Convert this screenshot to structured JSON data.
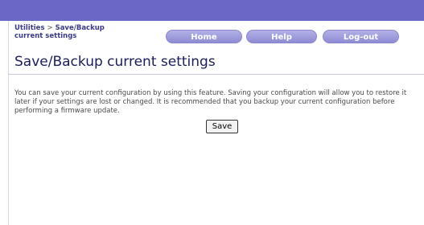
{
  "header": {
    "breadcrumb": {
      "section": "Utilities",
      "separator": ">",
      "page_line1": "Save/Backup",
      "page_line2": "current settings"
    },
    "nav": {
      "home_label": "Home",
      "help_label": "Help",
      "logout_label": "Log-out"
    }
  },
  "main": {
    "title": "Save/Backup current settings",
    "description": "You can save your current configuration by using this feature. Saving your configuration will allow you to restore it later if your settings are lost or changed. It is recommended that you backup your current configuration before performing a firmware update.",
    "save_label": "Save"
  },
  "colors": {
    "top_bar": "#6b67c6",
    "nav_button": "#9d9bdc",
    "title_text": "#1c1c5c"
  }
}
